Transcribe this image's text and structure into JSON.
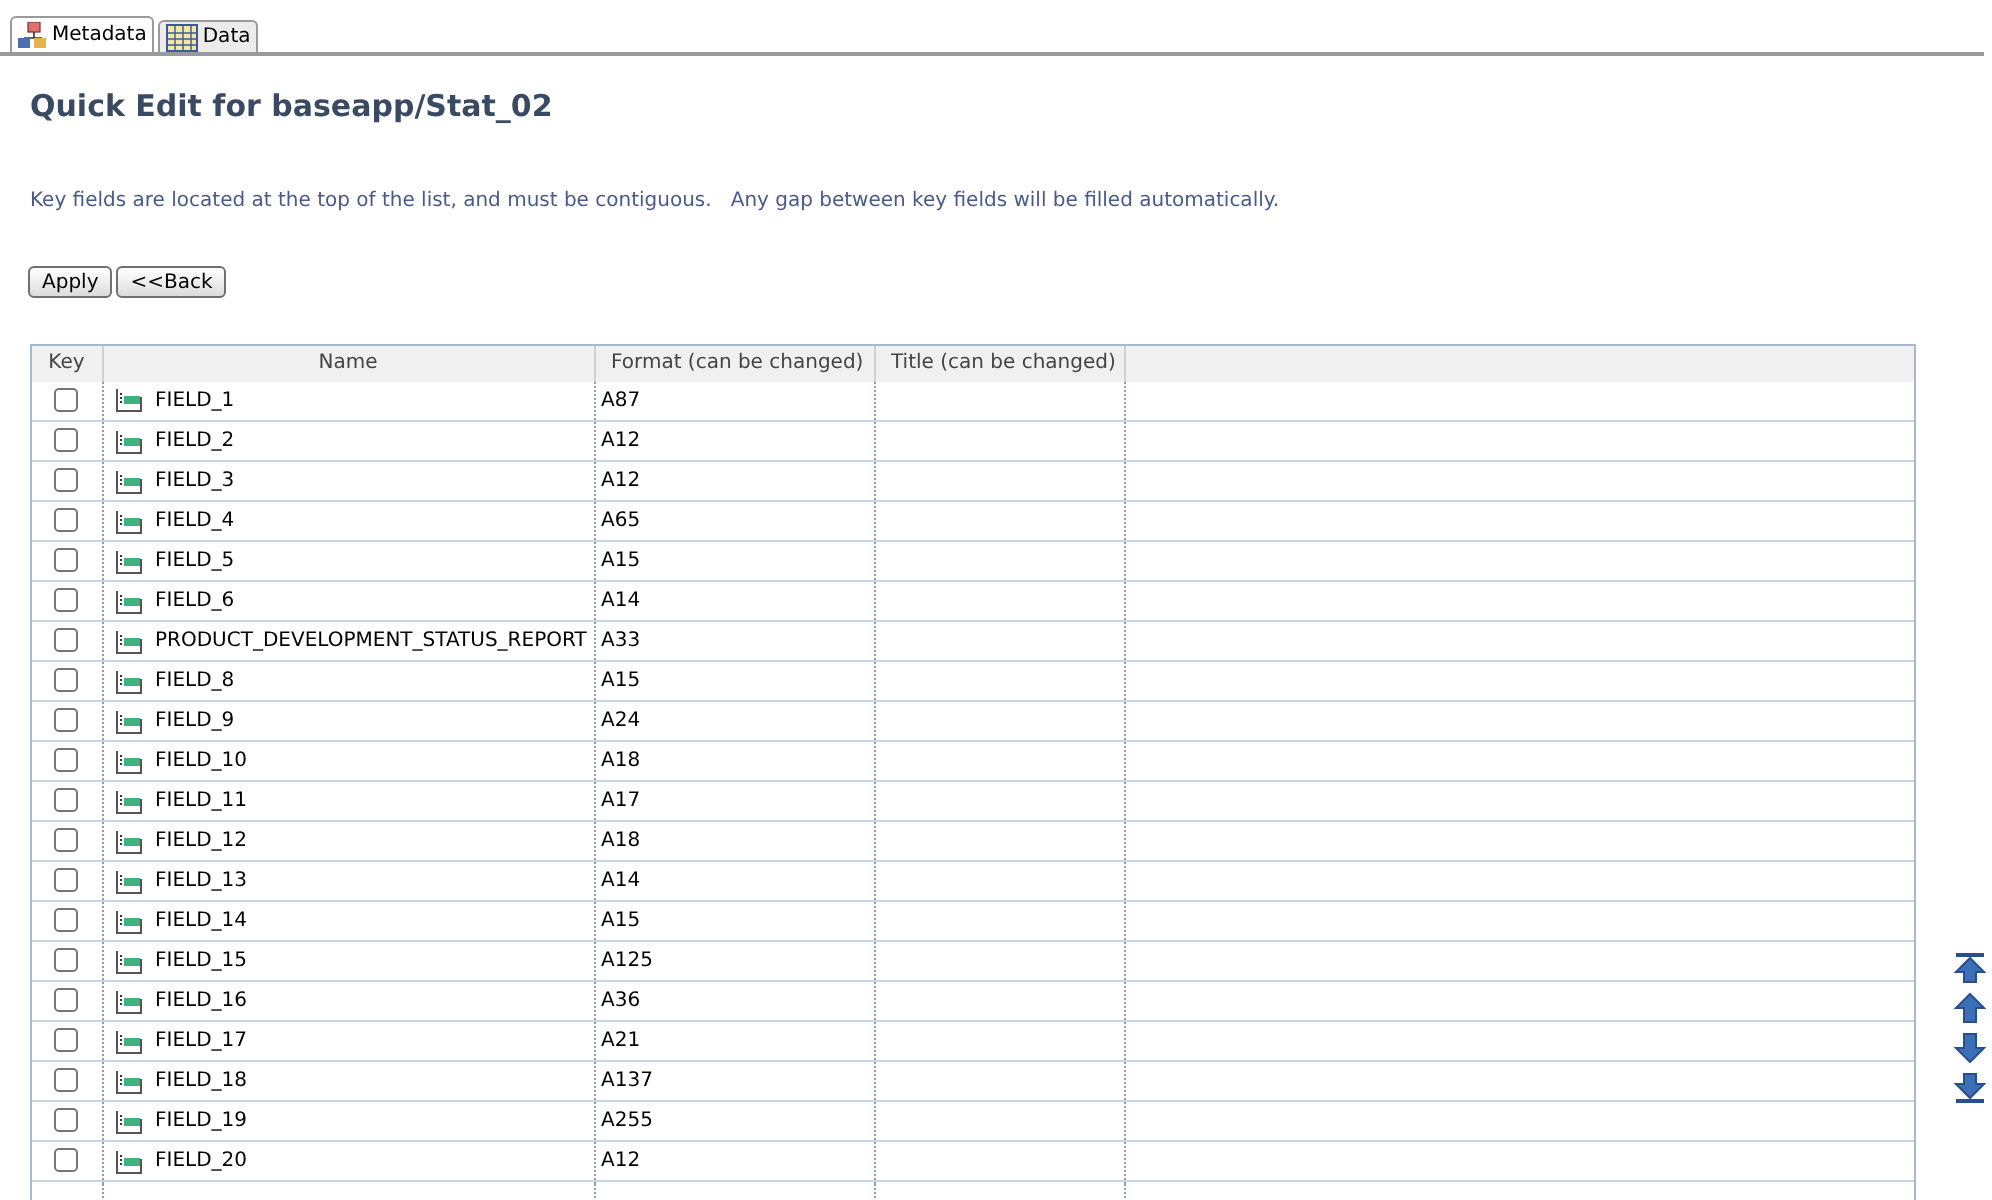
{
  "tabs": [
    {
      "label": "Metadata",
      "selected": true,
      "kind": "metadata"
    },
    {
      "label": "Data",
      "selected": false,
      "kind": "data"
    }
  ],
  "heading": "Quick Edit for baseapp/Stat_02",
  "note": "Key fields are located at the top of the list, and must be contiguous.   Any gap between key fields will be filled automatically.",
  "buttons": [
    "Apply",
    "<<Back"
  ],
  "table": {
    "columns": [
      "Key",
      "Name",
      "Format (can be changed)",
      "Title (can be changed)"
    ],
    "rows": [
      {
        "checked": false,
        "name": "FIELD_1",
        "format": "A87"
      },
      {
        "checked": false,
        "name": "FIELD_2",
        "format": "A12"
      },
      {
        "checked": false,
        "name": "FIELD_3",
        "format": "A12"
      },
      {
        "checked": false,
        "name": "FIELD_4",
        "format": "A65"
      },
      {
        "checked": false,
        "name": "FIELD_5",
        "format": "A15"
      },
      {
        "checked": false,
        "name": "FIELD_6",
        "format": "A14"
      },
      {
        "checked": false,
        "name": "PRODUCT_DEVELOPMENT_STATUS_REPORT",
        "format": "A33"
      },
      {
        "checked": false,
        "name": "FIELD_8",
        "format": "A15"
      },
      {
        "checked": false,
        "name": "FIELD_9",
        "format": "A24"
      },
      {
        "checked": false,
        "name": "FIELD_10",
        "format": "A18"
      },
      {
        "checked": false,
        "name": "FIELD_11",
        "format": "A17"
      },
      {
        "checked": false,
        "name": "FIELD_12",
        "format": "A18"
      },
      {
        "checked": false,
        "name": "FIELD_13",
        "format": "A14"
      },
      {
        "checked": false,
        "name": "FIELD_14",
        "format": "A15"
      },
      {
        "checked": false,
        "name": "FIELD_15",
        "format": "A125"
      },
      {
        "checked": false,
        "name": "FIELD_16",
        "format": "A36"
      },
      {
        "checked": false,
        "name": "FIELD_17",
        "format": "A21"
      },
      {
        "checked": false,
        "name": "FIELD_18",
        "format": "A137"
      },
      {
        "checked": false,
        "name": "FIELD_19",
        "format": "A255"
      },
      {
        "checked": false,
        "name": "FIELD_20",
        "format": "A12"
      }
    ]
  },
  "move_buttons": [
    {
      "kind": "top"
    },
    {
      "kind": "up"
    },
    {
      "kind": "down"
    },
    {
      "kind": "bottom"
    }
  ]
}
